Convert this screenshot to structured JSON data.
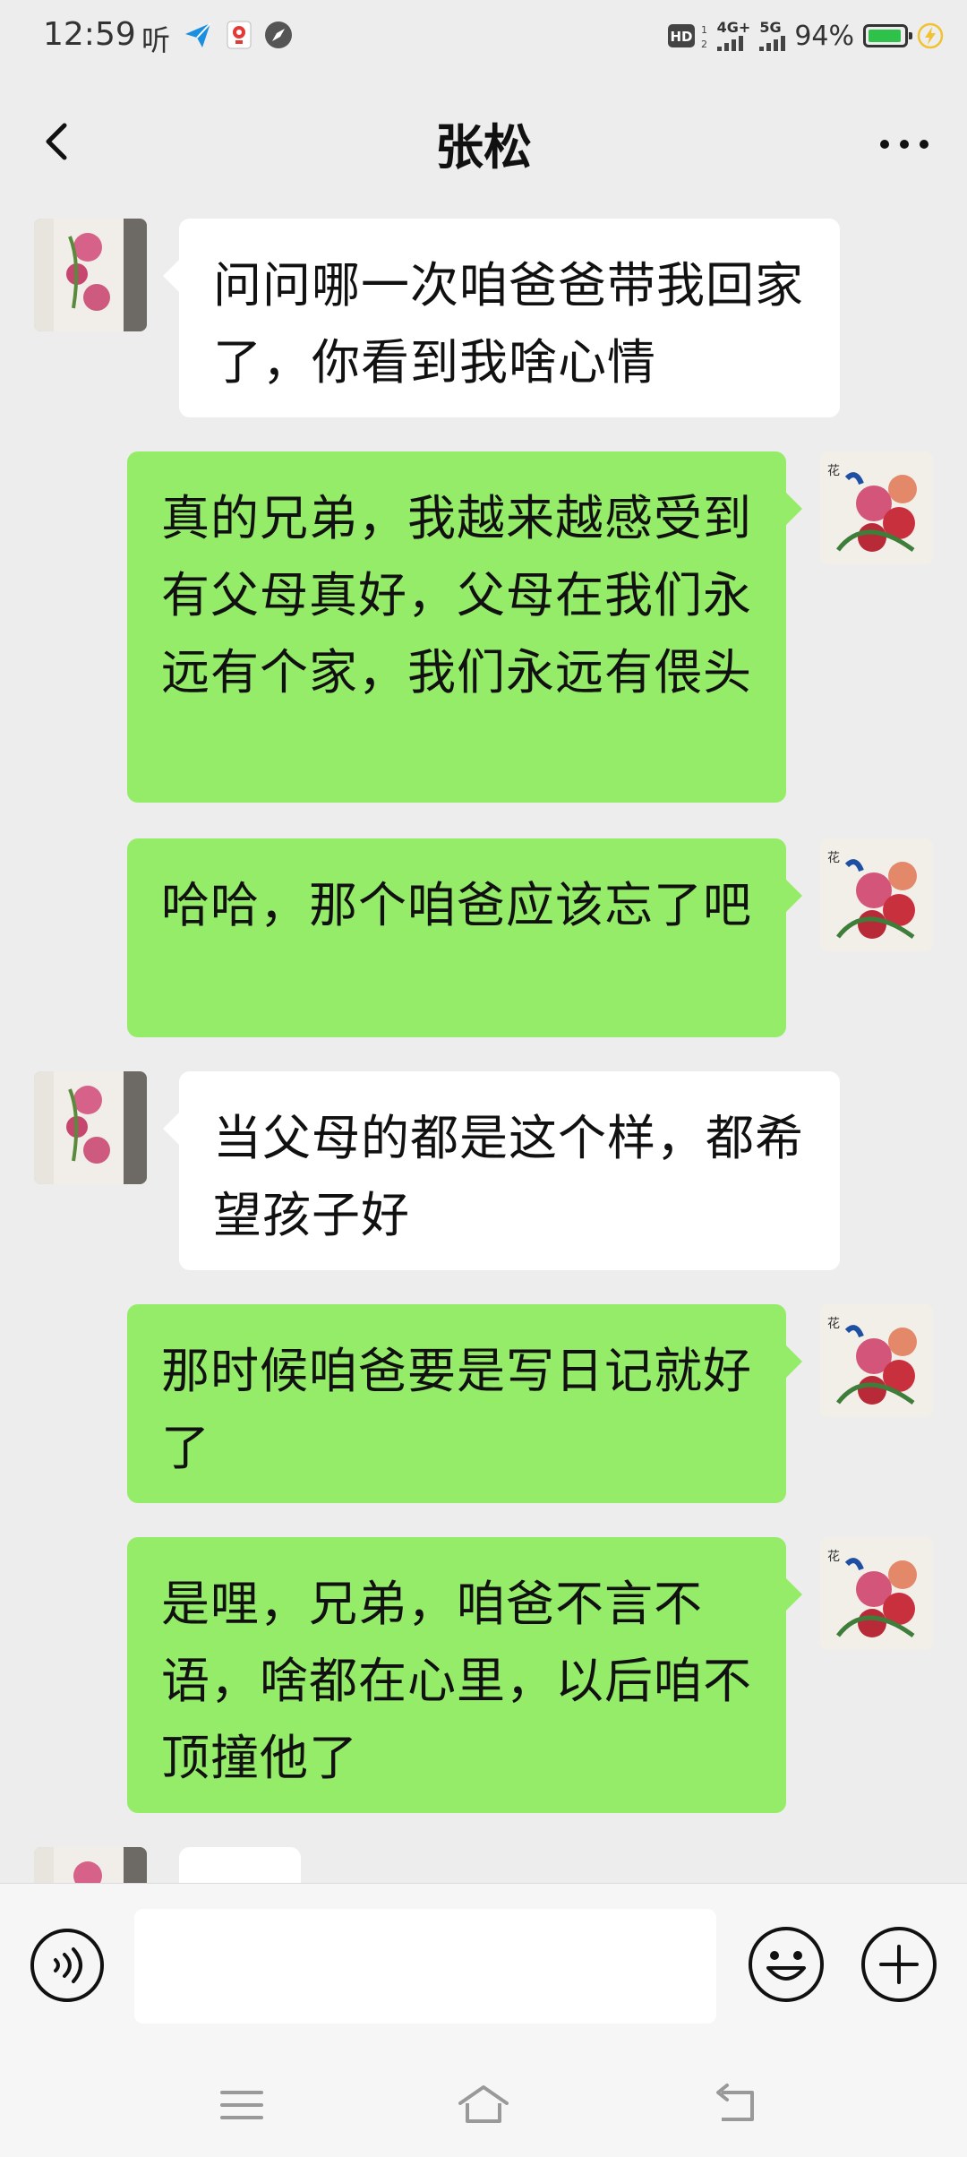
{
  "status_bar": {
    "time": "12:59",
    "ting": "听",
    "net_1": "4G+",
    "net_2": "5G",
    "battery_text": "94%",
    "battery_level": 0.94,
    "hd_label": "HD"
  },
  "header": {
    "title": "张松",
    "back_icon": "chevron-left-icon",
    "more_icon": "more-dots-icon"
  },
  "messages": [
    {
      "side": "in",
      "text": "问问哪一次咱爸爸带我回家了，你看到我啥心情"
    },
    {
      "side": "out",
      "text": "真的兄弟，我越来越感受到有父母真好，父母在我们永远有个家，我们永远有偎头"
    },
    {
      "side": "out",
      "text": "哈哈，那个咱爸应该忘了吧"
    },
    {
      "side": "in",
      "text": "当父母的都是这个样，都希望孩子好"
    },
    {
      "side": "out",
      "text": "那时候咱爸要是写日记就好了"
    },
    {
      "side": "out",
      "text": "是哩，兄弟，咱爸不言不语，啥都在心里，以后咱不顶撞他了"
    },
    {
      "side": "in",
      "text": ""
    }
  ],
  "input_bar": {
    "placeholder": "",
    "voice_icon": "voice-icon",
    "emoji_icon": "emoji-icon",
    "plus_icon": "plus-circle-icon"
  },
  "nav_bar": {
    "menu_icon": "menu-icon",
    "home_icon": "home-icon",
    "back_icon": "back-arrow-icon"
  },
  "colors": {
    "background": "#ededed",
    "incoming_bubble": "#ffffff",
    "outgoing_bubble": "#95ec69",
    "battery": "#2ec24a"
  }
}
